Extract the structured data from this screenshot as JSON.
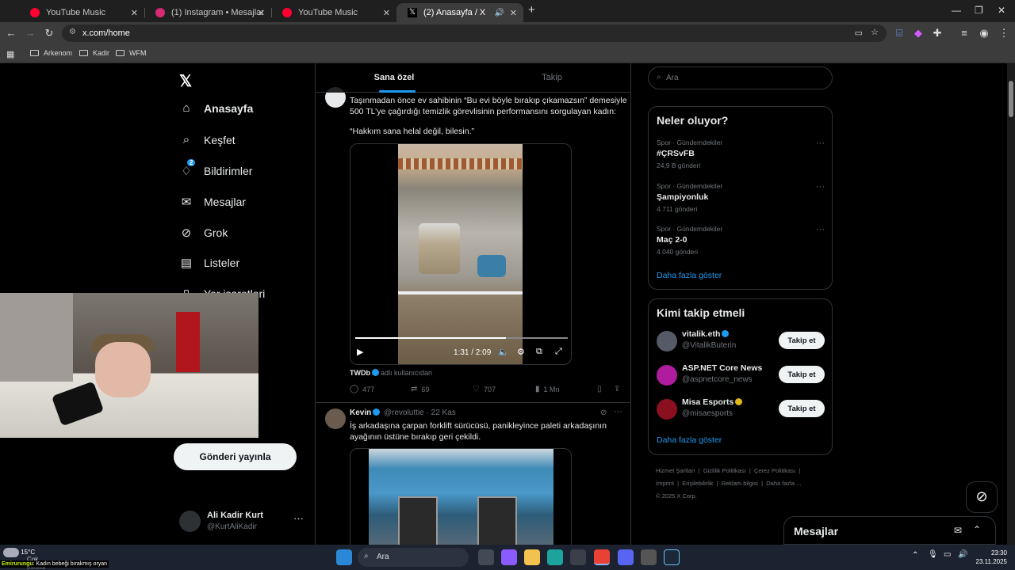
{
  "browser": {
    "tabs": [
      {
        "title": "YouTube Music",
        "color": "#ff0033"
      },
      {
        "title": "(1) Instagram • Mesajlar",
        "color": "#d62976"
      },
      {
        "title": "YouTube Music",
        "color": "#ff0033"
      },
      {
        "title": "(2) Anasayfa / X",
        "color": "#ffffff"
      }
    ],
    "url": "x.com/home",
    "bookmarks": [
      "Arkenom",
      "Kadir",
      "WFM"
    ]
  },
  "sidebar": {
    "nav": [
      {
        "label": "Anasayfa",
        "icon": "home-icon",
        "glyph": "⌂"
      },
      {
        "label": "Keşfet",
        "icon": "search-icon",
        "glyph": "⌕"
      },
      {
        "label": "Bildirimler",
        "icon": "bell-icon",
        "glyph": "♫",
        "badge": "2"
      },
      {
        "label": "Mesajlar",
        "icon": "mail-icon",
        "glyph": "✉"
      },
      {
        "label": "Grok",
        "icon": "grok-icon",
        "glyph": "⊘"
      },
      {
        "label": "Listeler",
        "icon": "list-icon",
        "glyph": "▤"
      },
      {
        "label": "Yer işaretleri",
        "icon": "bookmark-icon",
        "glyph": "▯"
      }
    ],
    "post_button": "Gönderi yayınla",
    "profile": {
      "name": "Ali Kadir Kurt",
      "handle": "@KurtAliKadir"
    }
  },
  "timeline": {
    "tabs": [
      "Sana özel",
      "Takip"
    ],
    "tweet1": {
      "text": "Taşınmadan önce ev sahibinin “Bu evi böyle bırakıp çıkamazsın” demesiyle 500 TL’ye çağırdığı temizlik görevlisinin performansını sorgulayan kadın:",
      "quote": "“Hakkım sana helal değil, bilesin.”",
      "video_time": "1:31 / 2:09",
      "progress": 0.71,
      "attribution_user": "TWDb",
      "attribution_suffix": "adlı kullanıcıdan",
      "stats": {
        "replies": "477",
        "reposts": "69",
        "likes": "707",
        "views": "1 Mn"
      }
    },
    "tweet2": {
      "name": "Kevin",
      "handle": "@revoluttie",
      "date": "· 22 Kas",
      "text": "İş arkadaşına çarpan forklift sürücüsü, panikleyince paleti arkadaşının ayağının üstüne bırakıp geri çekildi."
    }
  },
  "right": {
    "search_placeholder": "Ara",
    "trends_title": "Neler oluyor?",
    "trends": [
      {
        "category": "Spor · Gündemdekiler",
        "name": "#ÇRSvFB",
        "count": "24,9 B gönderi"
      },
      {
        "category": "Spor · Gündemdekiler",
        "name": "Şampiyonluk",
        "count": "4.711 gönderi"
      },
      {
        "category": "Spor · Gündemdekiler",
        "name": "Maç 2-0",
        "count": "4.040 gönderi"
      }
    ],
    "show_more": "Daha fazla göster",
    "who_title": "Kimi takip etmeli",
    "who": [
      {
        "name": "vitalik.eth",
        "handle": "@VitalikButerin",
        "color": "#555a66"
      },
      {
        "name": "ASP.NET Core News",
        "handle": "@aspnetcore_news",
        "color": "#b01c9e"
      },
      {
        "name": "Misa Esports",
        "handle": "@misaesports",
        "color": "#8a1020"
      }
    ],
    "follow_label": "Takip et",
    "footer": [
      "Hizmet Şartları",
      "Gizlilik Politikası",
      "Çerez Politikası",
      "Imprint",
      "Erişilebilirlik",
      "Reklam bilgisi",
      "Daha fazla ...",
      "© 2025 X Corp."
    ]
  },
  "messages_drawer": "Mesajlar",
  "taskbar": {
    "weather_temp": "15°C",
    "weather_desc": "Çok bulutlu",
    "ticker_name": "Emirurungu",
    "ticker_text": ": Kadın bebeği bırakmış oryan",
    "search": "Ara",
    "time": "23:30",
    "date": "23.11.2025"
  }
}
